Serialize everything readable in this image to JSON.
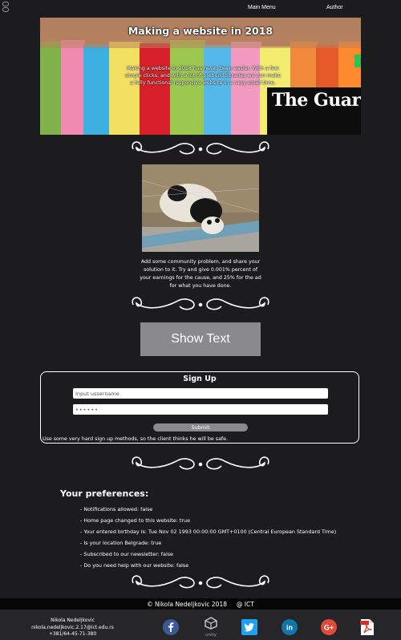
{
  "nav": {
    "main_menu": "Main Menu",
    "author": "Author"
  },
  "hero": {
    "title": "Making a website in 2018",
    "text": "Making a website in 2018 has never been easier. With a few simple clicks, and with a lot of prebuild libraries we can make a fully functional responsive website in a very small time.",
    "logo_text": "The Guardian"
  },
  "panda": {
    "caption": "Add some community problem, and share your solution to it. Try and give 0.001% percent of your earnings for the cause, and 25% for the ad for what you have done."
  },
  "show_text_label": "Show Text",
  "signup": {
    "title": "Sign Up",
    "username_placeholder": "Input ussername",
    "password_value": "••••••",
    "submit_label": "Submit",
    "note": "Use some very hard sign up methods, so the client thinks he will be safe."
  },
  "preferences": {
    "title": "Your preferences:",
    "items": [
      "- Notifications allowed: false",
      "- Home page changed to this website: true",
      "- Your entered birthday is: Tue Nov 02 1993 00:00:00 GMT+0100 (Central European Standard Time)",
      "- Is your location Belgrade: true",
      "- Subscribed to our newsletter: false",
      "- Do you need help with our website: false"
    ]
  },
  "footer": {
    "copyright": "© Nikola Nedeljkovic 2018     @ ICT",
    "contact": {
      "name": "Nikola Nedeljkovic",
      "email": "nikola.nedeljkovic.2.17@ict.edu.rs",
      "phone": "+381/64-45-71-380"
    },
    "social": [
      "facebook-icon",
      "unity-icon",
      "twitter-icon",
      "linkedin-icon",
      "google-plus-icon",
      "pdf-icon"
    ],
    "unity_label": "unity"
  },
  "colors": {
    "background": "#1c1b1e",
    "button_gray": "#8a8a8e",
    "facebook": "#3b5998",
    "twitter": "#1da1f2",
    "linkedin": "#0e76a8",
    "google_plus": "#dd4b39",
    "pdf": "#d32f2f"
  }
}
